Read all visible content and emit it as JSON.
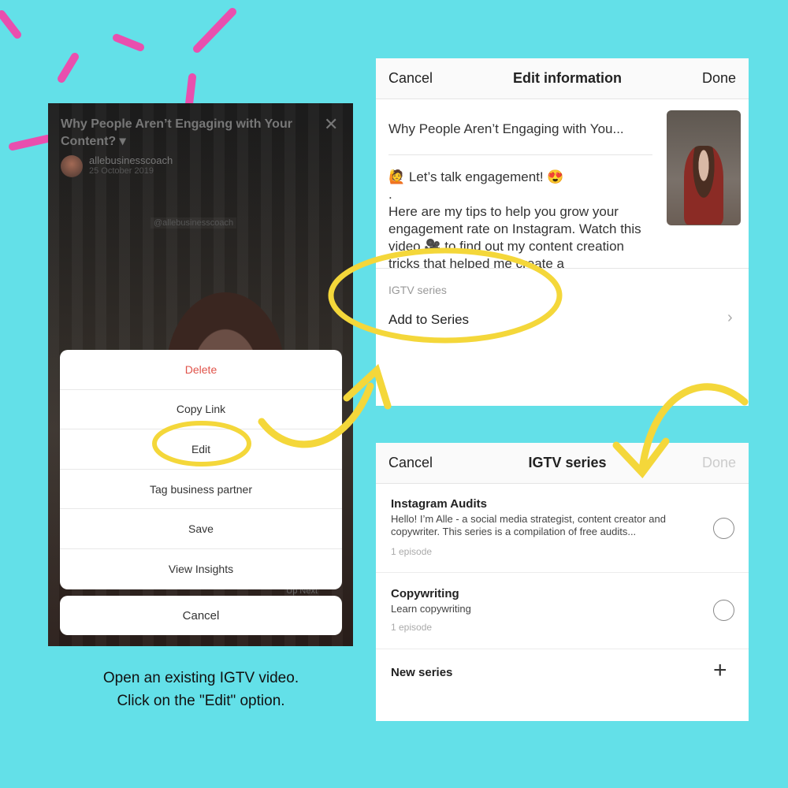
{
  "colors": {
    "background": "#63e0e8",
    "accent_dashes": "#e94fae",
    "highlight": "#f4d73a",
    "delete": "#e0534a"
  },
  "video_screen": {
    "title": "Why People Aren’t Engaging with Your Content? ▾",
    "close_icon": "close-icon",
    "username": "allebusinesscoach",
    "date": "25 October 2019",
    "watermark": "@allebusinesscoach",
    "up_next": "⌃ Up Next",
    "menu": [
      "Delete",
      "Copy Link",
      "Edit",
      "Tag business partner",
      "Save",
      "View Insights"
    ],
    "cancel": "Cancel"
  },
  "caption": {
    "line1": "Open an existing IGTV video.",
    "line2": "Click on the \"Edit\" option."
  },
  "edit_info": {
    "cancel": "Cancel",
    "title": "Edit information",
    "done": "Done",
    "video_title": "Why People Aren’t Engaging with You...",
    "description": "🙋 Let’s talk engagement! 😍\n.\nHere are my tips to help you grow your engagement rate on Instagram. Watch this video 🎥 to find out my content creation tricks that helped me create a",
    "series_label": "IGTV series",
    "add_to_series": "Add to Series",
    "chevron": "›"
  },
  "igtv_series": {
    "cancel": "Cancel",
    "title": "IGTV series",
    "done": "Done",
    "items": [
      {
        "name": "Instagram Audits",
        "description": "Hello! I’m Alle - a social media strategist, content creator and copywriter. This series is a compilation of free audits...",
        "episodes": "1 episode",
        "selected": false
      },
      {
        "name": "Copywriting",
        "description": "Learn copywriting",
        "episodes": "1 episode",
        "selected": false
      }
    ],
    "new_series": "New series",
    "plus": "+"
  }
}
